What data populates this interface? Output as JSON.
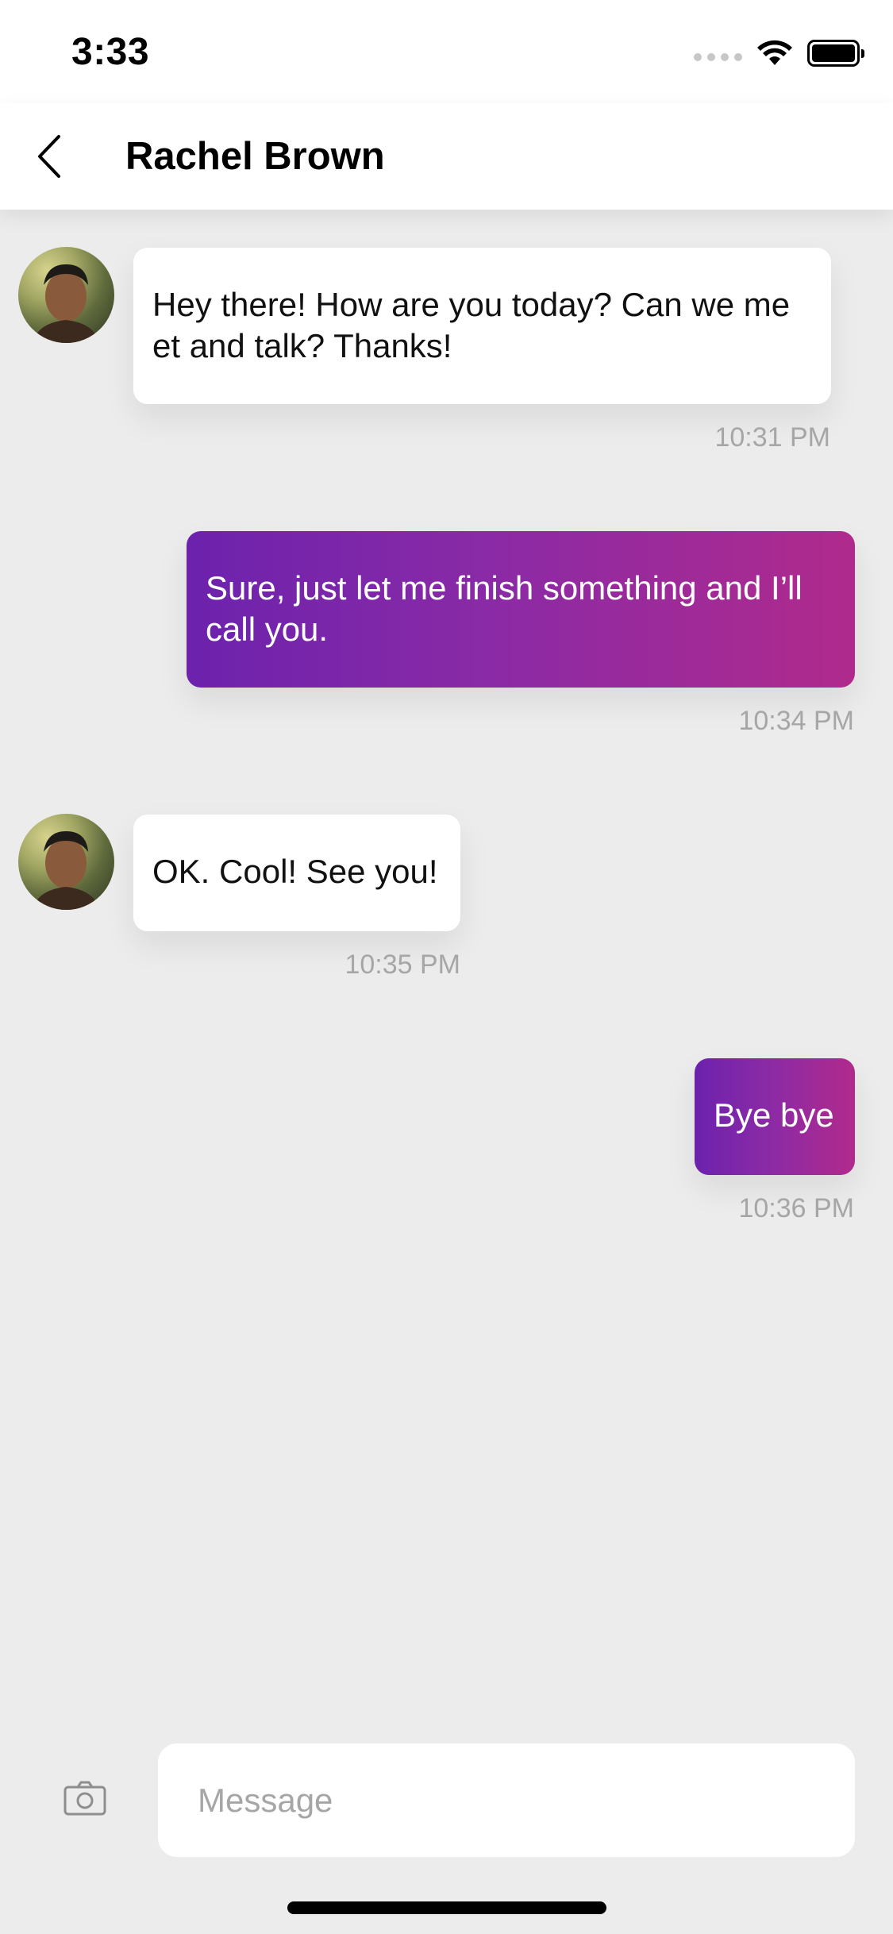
{
  "status_bar": {
    "time": "3:33",
    "icons": [
      "signal-icon",
      "wifi-icon",
      "battery-icon"
    ]
  },
  "header": {
    "title": "Rachel Brown",
    "back_icon": "chevron-left-icon"
  },
  "messages": [
    {
      "direction": "incoming",
      "text": "Hey there! How are you today? Can we me\net and talk? Thanks!",
      "time": "10:31 PM",
      "avatar": "avatar"
    },
    {
      "direction": "outgoing",
      "text": "Sure, just let me finish something and I’ll\ncall you.",
      "time": "10:34 PM"
    },
    {
      "direction": "incoming",
      "text": "OK. Cool! See you!",
      "time": "10:35 PM",
      "avatar": "avatar"
    },
    {
      "direction": "outgoing",
      "text": "Bye bye",
      "time": "10:36 PM"
    }
  ],
  "composer": {
    "placeholder": "Message",
    "value": "",
    "camera_icon": "camera-icon"
  },
  "colors": {
    "background": "#ececec",
    "bubble_in": "#ffffff",
    "bubble_out_start": "#6c22ad",
    "bubble_out_end": "#b02a8c",
    "timestamp": "#a6a6a6"
  }
}
